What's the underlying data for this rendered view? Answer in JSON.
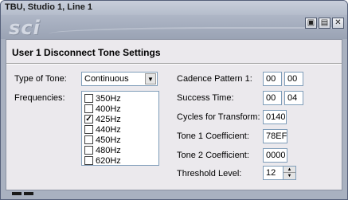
{
  "window": {
    "title": "TBU, Studio 1, Line 1",
    "logo": "sci",
    "buttons": {
      "restore_icon": "restore-icon",
      "maximize_icon": "maximize-icon",
      "close_icon": "close-icon"
    }
  },
  "heading": "User 1 Disconnect Tone Settings",
  "type_of_tone": {
    "label": "Type of Tone:",
    "value": "Continuous"
  },
  "frequencies": {
    "label": "Frequencies:",
    "items": [
      {
        "label": "350Hz",
        "checked": false
      },
      {
        "label": "400Hz",
        "checked": false
      },
      {
        "label": "425Hz",
        "checked": true
      },
      {
        "label": "440Hz",
        "checked": false
      },
      {
        "label": "450Hz",
        "checked": false
      },
      {
        "label": "480Hz",
        "checked": false
      },
      {
        "label": "620Hz",
        "checked": false
      }
    ]
  },
  "cadence": {
    "label": "Cadence Pattern 1:",
    "value1": "00",
    "value2": "00"
  },
  "success_time": {
    "label": "Success Time:",
    "value1": "00",
    "value2": "04"
  },
  "cycles": {
    "label": "Cycles for Transform:",
    "value": "0140"
  },
  "tone1": {
    "label": "Tone 1 Coefficient:",
    "value": "78EF"
  },
  "tone2": {
    "label": "Tone 2 Coefficient:",
    "value": "0000"
  },
  "threshold": {
    "label": "Threshold Level:",
    "value": "12"
  }
}
